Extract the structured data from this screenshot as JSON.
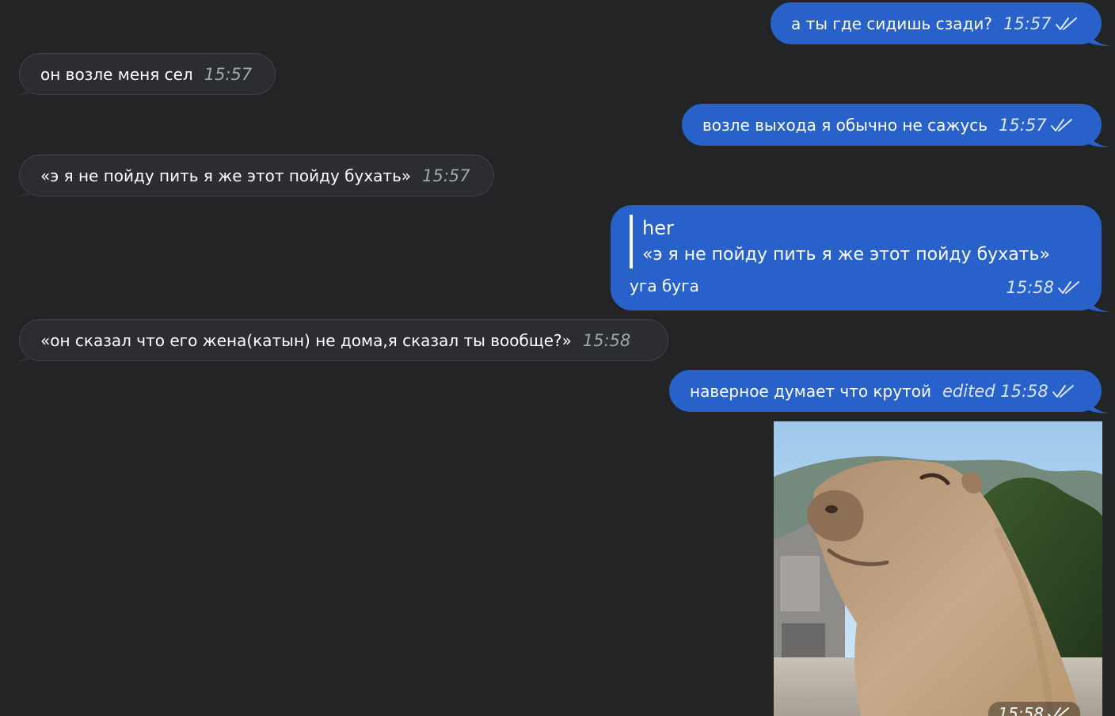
{
  "theme": {
    "background": "#222426",
    "incoming_bubble": "#2b2d30",
    "outgoing_bubble": "#2761c9"
  },
  "messages": [
    {
      "direction": "out",
      "text": "а ты где сидишь сзади?",
      "meta": "15:57",
      "read_icon": "double-check-icon"
    },
    {
      "direction": "in",
      "text": "он возле меня сел",
      "meta": "15:57"
    },
    {
      "direction": "out",
      "text": "возле выхода я обычно не сажусь",
      "meta": "15:57",
      "read_icon": "double-check-icon"
    },
    {
      "direction": "in",
      "text": "«э я не пойду пить я же этот пойду бухать»",
      "meta": "15:57"
    },
    {
      "direction": "out",
      "reply": {
        "name": "her",
        "quote": "«э я не пойду пить я же этот пойду бухать»"
      },
      "text": "уга буга",
      "meta": "15:58",
      "read_icon": "double-check-icon"
    },
    {
      "direction": "in",
      "text": "«он сказал что его жена(катын) не дома,я сказал ты вообще?»",
      "meta": "15:58"
    },
    {
      "direction": "out",
      "text": "наверное думает что крутой",
      "meta": "edited 15:58",
      "read_icon": "double-check-icon"
    },
    {
      "direction": "out",
      "type": "photo",
      "photo_subject": "capybara",
      "meta": "15:58",
      "read_icon": "double-check-icon"
    }
  ]
}
